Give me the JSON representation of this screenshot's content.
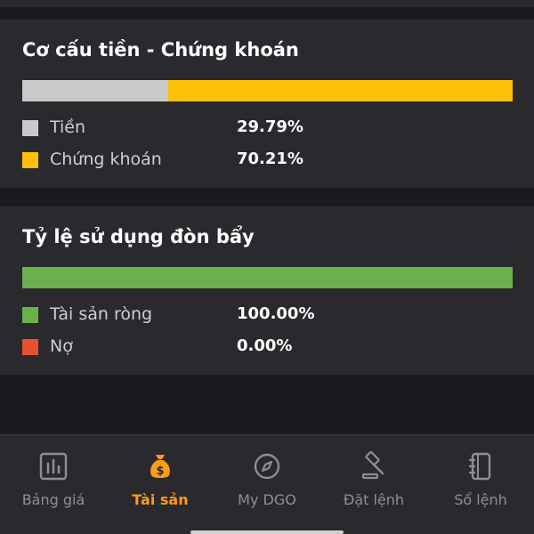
{
  "colors": {
    "background": "#1b1b1f",
    "card": "#2a2a2e",
    "cash": "#c9c9c9",
    "stock": "#ffc107",
    "net_asset": "#6ab04c",
    "debt": "#e5532d",
    "nav_active": "#ff9b1a",
    "nav_inactive": "#8e8e93"
  },
  "cash_stock": {
    "title": "Cơ cấu tiền - Chứng khoán",
    "items": [
      {
        "label": "Tiền",
        "value": "29.79%",
        "fraction": 0.2979,
        "color": "#c9c9c9"
      },
      {
        "label": "Chứng khoán",
        "value": "70.21%",
        "fraction": 0.7021,
        "color": "#ffc107"
      }
    ]
  },
  "leverage": {
    "title": "Tỷ lệ sử dụng đòn bẩy",
    "items": [
      {
        "label": "Tài sản ròng",
        "value": "100.00%",
        "fraction": 1.0,
        "color": "#6ab04c"
      },
      {
        "label": "Nợ",
        "value": "0.00%",
        "fraction": 0.0,
        "color": "#e5532d"
      }
    ]
  },
  "nav": {
    "items": [
      {
        "label": "Bảng giá",
        "icon": "chart-icon",
        "active": false
      },
      {
        "label": "Tài sản",
        "icon": "money-bag-icon",
        "active": true
      },
      {
        "label": "My DGO",
        "icon": "compass-icon",
        "active": false
      },
      {
        "label": "Đặt lệnh",
        "icon": "gavel-icon",
        "active": false
      },
      {
        "label": "Sổ lệnh",
        "icon": "notebook-icon",
        "active": false
      }
    ]
  }
}
